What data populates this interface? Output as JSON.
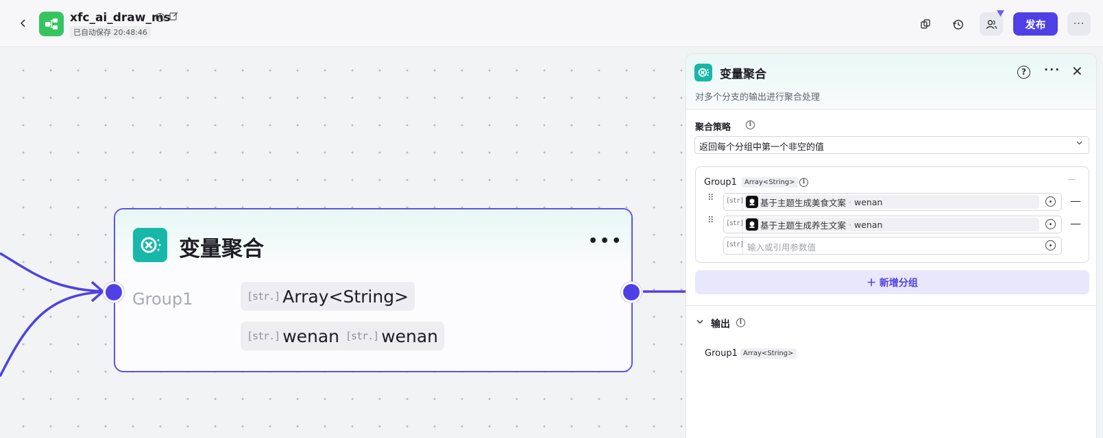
{
  "topbar": {
    "app_name": "xfc_ai_draw_ms",
    "autosave": "已自动保存 20:48:46",
    "publish_label": "发布",
    "back_icon": "chevron-left-icon",
    "more_label": "···"
  },
  "node": {
    "title": "变量聚合",
    "more": "•••",
    "group_name": "Group1",
    "type_tag": "[str.]",
    "type_label": "Array<String>",
    "var1": "wenan",
    "var2": "wenan"
  },
  "panel": {
    "title": "变量聚合",
    "description": "对多个分支的输出进行聚合处理",
    "help": "?",
    "more": "···",
    "close": "✕",
    "strategy_label": "聚合策略",
    "strategy_value": "返回每个分组中第一个非空的值",
    "group": {
      "name": "Group1",
      "type": "Array<String>",
      "rows": [
        {
          "tag": "[str]",
          "source": "基于主题生成美食文案",
          "var": "wenan"
        },
        {
          "tag": "[str]",
          "source": "基于主题生成养生文案",
          "var": "wenan"
        }
      ],
      "empty_row": {
        "tag": "[str]",
        "placeholder": "输入或引用参数值"
      }
    },
    "add_group_label": "＋ 新增分组",
    "output_label": "输出",
    "output": {
      "name": "Group1",
      "type": "Array<String>"
    }
  },
  "colors": {
    "accent": "#4e40e5",
    "node_icon": "#17b7a9",
    "app_logo": "#35c560"
  }
}
